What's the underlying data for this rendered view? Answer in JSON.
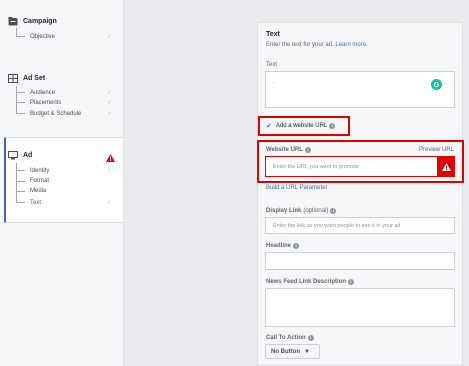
{
  "sidebar": {
    "campaign": {
      "label": "Campaign",
      "items": [
        {
          "label": "Objective"
        }
      ]
    },
    "adset": {
      "label": "Ad Set",
      "items": [
        {
          "label": "Audience"
        },
        {
          "label": "Placements"
        },
        {
          "label": "Budget & Schedule"
        }
      ]
    },
    "ad": {
      "label": "Ad",
      "items": [
        {
          "label": "Identity"
        },
        {
          "label": "Format"
        },
        {
          "label": "Media"
        },
        {
          "label": "Text"
        }
      ]
    }
  },
  "text_section": {
    "title": "Text",
    "description": "Enter the text for your ad.",
    "learn_more": "Learn more.",
    "text_label": "Text",
    "text_value": "-"
  },
  "website": {
    "checkbox_label": "Add a website URL",
    "url_label": "Website URL",
    "preview_label": "Preview URL",
    "url_placeholder": "Enter the URL you want to promote",
    "build_param": "Build a URL Parameter"
  },
  "display_link": {
    "label": "Display Link",
    "optional": "(optional)",
    "placeholder": "Enter the link as you want people to see it in your ad"
  },
  "headline": {
    "label": "Headline"
  },
  "news_feed": {
    "label": "News Feed Link Description"
  },
  "cta": {
    "label": "Call To Action",
    "value": "No Button"
  },
  "colors": {
    "accent": "#4267b2",
    "error": "#e00000",
    "grammarly": "#15c39a"
  }
}
